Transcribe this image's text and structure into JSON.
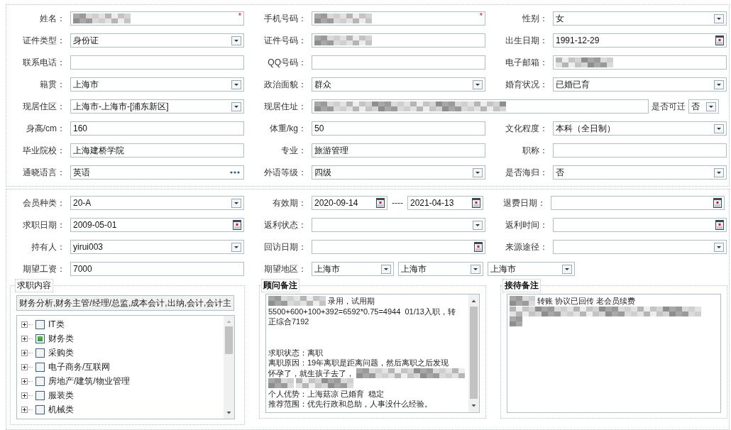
{
  "personal_info": {
    "rows": [
      [
        {
          "label": "姓名：",
          "kind": "text",
          "redacted": true,
          "marker": "*"
        },
        {
          "label": "手机号码：",
          "kind": "text",
          "redacted": true,
          "marker": "*"
        },
        {
          "label": "性别：",
          "kind": "select",
          "value": "女"
        }
      ],
      [
        {
          "label": "证件类型：",
          "kind": "select",
          "value": "身份证"
        },
        {
          "label": "证件号码：",
          "kind": "text",
          "redacted": true
        },
        {
          "label": "出生日期：",
          "kind": "date",
          "value": "1991-12-29"
        }
      ],
      [
        {
          "label": "联系电话：",
          "kind": "text"
        },
        {
          "label": "QQ号码：",
          "kind": "text"
        },
        {
          "label": "电子邮箱：",
          "kind": "text",
          "redacted": true
        }
      ],
      [
        {
          "label": "籍贯：",
          "kind": "select",
          "value": "上海市"
        },
        {
          "label": "政治面貌：",
          "kind": "select",
          "value": "群众"
        },
        {
          "label": "婚育状况：",
          "kind": "select",
          "value": "已婚已育"
        }
      ],
      [
        {
          "label": "现居住区：",
          "kind": "select",
          "value": "上海市-上海市-[浦东新区]"
        },
        {
          "label": "现居住址：",
          "kind": "wide-text",
          "redacted": true
        },
        {
          "label": "是否可迁",
          "kind": "mini-select",
          "value": "否"
        }
      ],
      [
        {
          "label": "身高/cm：",
          "kind": "text",
          "value": "160"
        },
        {
          "label": "体重/kg：",
          "kind": "text",
          "value": "50"
        },
        {
          "label": "文化程度：",
          "kind": "select",
          "value": "本科（全日制）"
        }
      ],
      [
        {
          "label": "毕业院校：",
          "kind": "text",
          "value": "上海建桥学院"
        },
        {
          "label": "专业：",
          "kind": "text",
          "value": "旅游管理"
        },
        {
          "label": "职称：",
          "kind": "text"
        }
      ],
      [
        {
          "label": "通晓语言：",
          "kind": "lookup",
          "value": "英语"
        },
        {
          "label": "外语等级：",
          "kind": "select",
          "value": "四级"
        },
        {
          "label": "是否海归：",
          "kind": "select",
          "value": "否"
        }
      ]
    ]
  },
  "membership": {
    "rows": [
      [
        {
          "label": "会员种类：",
          "kind": "select",
          "value": "20-A"
        },
        {
          "label": "有效期：",
          "kind": "date-range",
          "value": "2020-09-14",
          "separator": "----",
          "value_to": "2021-04-13"
        },
        {
          "label": "退费日期：",
          "kind": "date"
        }
      ],
      [
        {
          "label": "求职日期：",
          "kind": "date",
          "value": "2009-05-01"
        },
        {
          "label": "返利状态：",
          "kind": "select"
        },
        {
          "label": "返利时间：",
          "kind": "date"
        }
      ],
      [
        {
          "label": "持有人：",
          "kind": "select",
          "value": "yirui003"
        },
        {
          "label": "回访日期：",
          "kind": "date"
        },
        {
          "label": "来源途径：",
          "kind": "select"
        }
      ],
      [
        {
          "label": "期望工资：",
          "kind": "text",
          "value": "7000"
        },
        {
          "label": "期望地区：",
          "kind": "select-group",
          "values": [
            "上海市",
            "上海市",
            "上海市"
          ]
        }
      ]
    ]
  },
  "job_categories": {
    "legend": "求职内容",
    "selection": "财务分析,财务主管/经理/总监,成本会计,出纳,会计,会计主",
    "items": [
      {
        "label": "IT类",
        "checked": false,
        "expanded": false
      },
      {
        "label": "财务类",
        "checked": true,
        "expanded": false
      },
      {
        "label": "采购类",
        "checked": false,
        "expanded": false
      },
      {
        "label": "电子商务/互联网",
        "checked": false,
        "expanded": false
      },
      {
        "label": "房地产/建筑/物业管理",
        "checked": false,
        "expanded": false
      },
      {
        "label": "服装类",
        "checked": false,
        "expanded": false
      },
      {
        "label": "机械类",
        "checked": false,
        "expanded": false
      }
    ]
  },
  "advisor_notes": {
    "legend": "顾问备注",
    "lines": [
      {
        "segments": [
          {
            "kind": "redacted"
          },
          {
            "kind": "text",
            "text": "录用，试用期"
          }
        ]
      },
      {
        "segments": [
          {
            "kind": "text",
            "text": "5500+600+100+392=6592*0.75=4944  01/13入职，转"
          }
        ]
      },
      {
        "segments": [
          {
            "kind": "text",
            "text": "正综合7192"
          }
        ]
      },
      {
        "paragraph_break": true,
        "segments": [
          {
            "kind": "text",
            "text": "求职状态：离职"
          }
        ]
      },
      {
        "segments": [
          {
            "kind": "text",
            "text": "离职原因：19年离职是距离问题，然后离职之后发现"
          }
        ]
      },
      {
        "segments": [
          {
            "kind": "text",
            "text": "怀孕了，就生孩子去了，"
          },
          {
            "kind": "redacted"
          }
        ]
      },
      {
        "segments": [
          {
            "kind": "redacted"
          },
          {
            "kind": "redacted"
          }
        ]
      },
      {
        "segments": [
          {
            "kind": "text",
            "text": "个人优势：上海菇凉 已婚育  稳定"
          }
        ]
      },
      {
        "segments": [
          {
            "kind": "text",
            "text": "推荐范围：优先行政和总助，人事没什么经验。"
          }
        ]
      }
    ]
  },
  "reception_notes": {
    "legend": "接待备注",
    "lines": [
      {
        "segments": [
          {
            "kind": "redacted"
          },
          {
            "kind": "text",
            "text": "转账 协议已回传 老会员续费"
          }
        ]
      },
      {
        "segments": [
          {
            "kind": "redacted"
          }
        ]
      },
      {
        "segments": [
          {
            "kind": "redacted"
          }
        ]
      }
    ]
  }
}
